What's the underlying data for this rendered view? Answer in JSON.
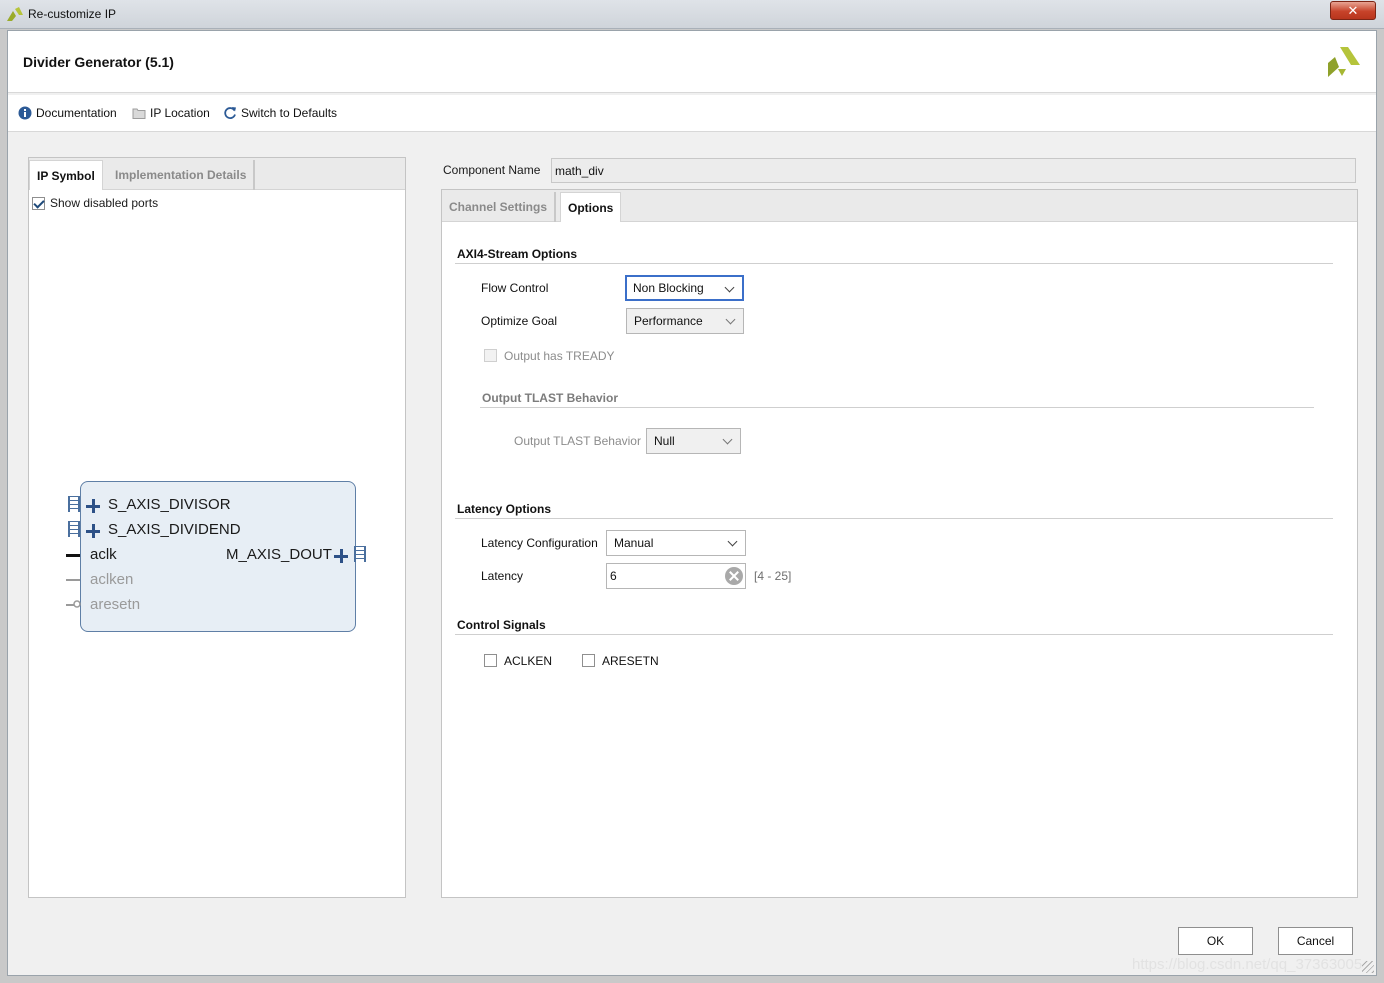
{
  "window": {
    "title": "Re-customize IP",
    "close_label": "✕"
  },
  "header": {
    "title": "Divider Generator (5.1)"
  },
  "toolbar": {
    "documentation": "Documentation",
    "ip_location": "IP Location",
    "switch_defaults": "Switch to Defaults"
  },
  "left_panel": {
    "tabs": [
      {
        "label": "IP Symbol",
        "active": true
      },
      {
        "label": "Implementation Details",
        "active": false
      }
    ],
    "show_disabled_ports": {
      "label": "Show disabled ports",
      "checked": true
    },
    "ip_symbol": {
      "input_bus_ports": [
        "S_AXIS_DIVISOR",
        "S_AXIS_DIVIDEND"
      ],
      "output_bus_ports": [
        "M_AXIS_DOUT"
      ],
      "signal_ports": [
        {
          "name": "aclk",
          "enabled": true
        },
        {
          "name": "aclken",
          "enabled": false
        },
        {
          "name": "aresetn",
          "enabled": false
        }
      ]
    }
  },
  "component_name": {
    "label": "Component Name",
    "value": "math_div"
  },
  "right_panel": {
    "tabs": [
      {
        "label": "Channel Settings",
        "active": false
      },
      {
        "label": "Options",
        "active": true
      }
    ],
    "axi4_stream": {
      "title": "AXI4-Stream Options",
      "flow_control": {
        "label": "Flow Control",
        "value": "Non Blocking"
      },
      "optimize_goal": {
        "label": "Optimize Goal",
        "value": "Performance"
      },
      "output_has_tready": {
        "label": "Output has TREADY",
        "checked": false,
        "enabled": false
      },
      "tlast_group": {
        "title": "Output TLAST Behavior",
        "label": "Output TLAST Behavior",
        "value": "Null"
      }
    },
    "latency": {
      "title": "Latency Options",
      "configuration": {
        "label": "Latency Configuration",
        "value": "Manual"
      },
      "latency": {
        "label": "Latency",
        "value": "6",
        "range": "[4 - 25]"
      }
    },
    "control_signals": {
      "title": "Control Signals",
      "aclken": {
        "label": "ACLKEN",
        "checked": false
      },
      "aresetn": {
        "label": "ARESETN",
        "checked": false
      }
    }
  },
  "buttons": {
    "ok": "OK",
    "cancel": "Cancel"
  },
  "watermark": "https://blog.csdn.net/qq_37363005",
  "colors": {
    "accent": "#3b6fc9",
    "symbol_border": "#5f7fa6",
    "symbol_fill": "#e7eef5",
    "logo": "#9aab2a"
  }
}
